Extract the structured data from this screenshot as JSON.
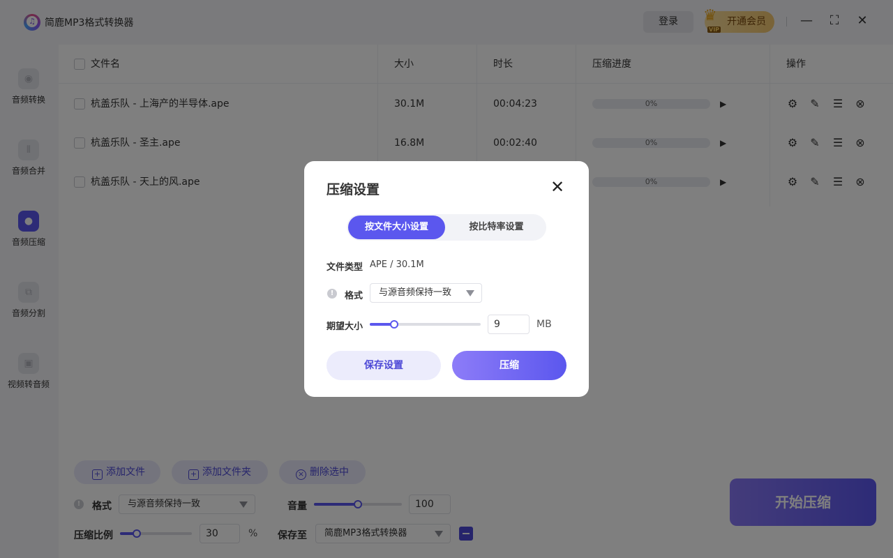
{
  "app": {
    "title": "简鹿MP3格式转换器"
  },
  "titlebar": {
    "login": "登录",
    "vip": "开通会员",
    "vip_tag": "VIP",
    "minimize": "—",
    "maximize": "⛶",
    "close": "✕"
  },
  "sidebar": {
    "items": [
      {
        "label": "音频转换",
        "icon": "audio-convert-icon",
        "glyph": "◉"
      },
      {
        "label": "音频合并",
        "icon": "audio-merge-icon",
        "glyph": "⫴"
      },
      {
        "label": "音频压缩",
        "icon": "microphone-icon",
        "glyph": "🎙"
      },
      {
        "label": "音频分割",
        "icon": "audio-split-icon",
        "glyph": "⧉"
      },
      {
        "label": "视频转音频",
        "icon": "video-to-audio-icon",
        "glyph": "▣"
      }
    ]
  },
  "table": {
    "headers": {
      "name": "文件名",
      "size": "大小",
      "duration": "时长",
      "progress": "压缩进度",
      "actions": "操作"
    },
    "rows": [
      {
        "name": "杭盖乐队 - 上海产的半导体.ape",
        "size": "30.1M",
        "duration": "00:04:23",
        "progress_text": "0%",
        "progress": 0
      },
      {
        "name": "杭盖乐队 - 圣主.ape",
        "size": "16.8M",
        "duration": "00:02:40",
        "progress_text": "0%",
        "progress": 0
      },
      {
        "name": "杭盖乐队 - 天上的风.ape",
        "size": "",
        "duration": "",
        "progress_text": "0%",
        "progress": 0
      }
    ]
  },
  "toolbar": {
    "add_file": "添加文件",
    "add_folder": "添加文件夹",
    "delete_selected": "删除选中"
  },
  "bottom": {
    "format_label": "格式",
    "format_value": "与源音频保持一致",
    "volume_label": "音量",
    "volume_value": "100",
    "volume_fraction": 0.5,
    "ratio_label": "压缩比例",
    "ratio_value": "30",
    "ratio_fraction": 0.23,
    "ratio_unit": "%",
    "save_to_label": "保存至",
    "save_to_value": "简鹿MP3格式转换器",
    "start": "开始压缩"
  },
  "dialog": {
    "title": "压缩设置",
    "tabs": [
      "按文件大小设置",
      "按比特率设置"
    ],
    "active_tab": 0,
    "file_type_label": "文件类型",
    "file_type_value": "APE / 30.1M",
    "format_label": "格式",
    "format_value": "与源音频保持一致",
    "size_label": "期望大小",
    "size_value": "9",
    "size_fraction": 0.22,
    "size_unit": "MB",
    "save_button": "保存设置",
    "compress_button": "压缩"
  }
}
